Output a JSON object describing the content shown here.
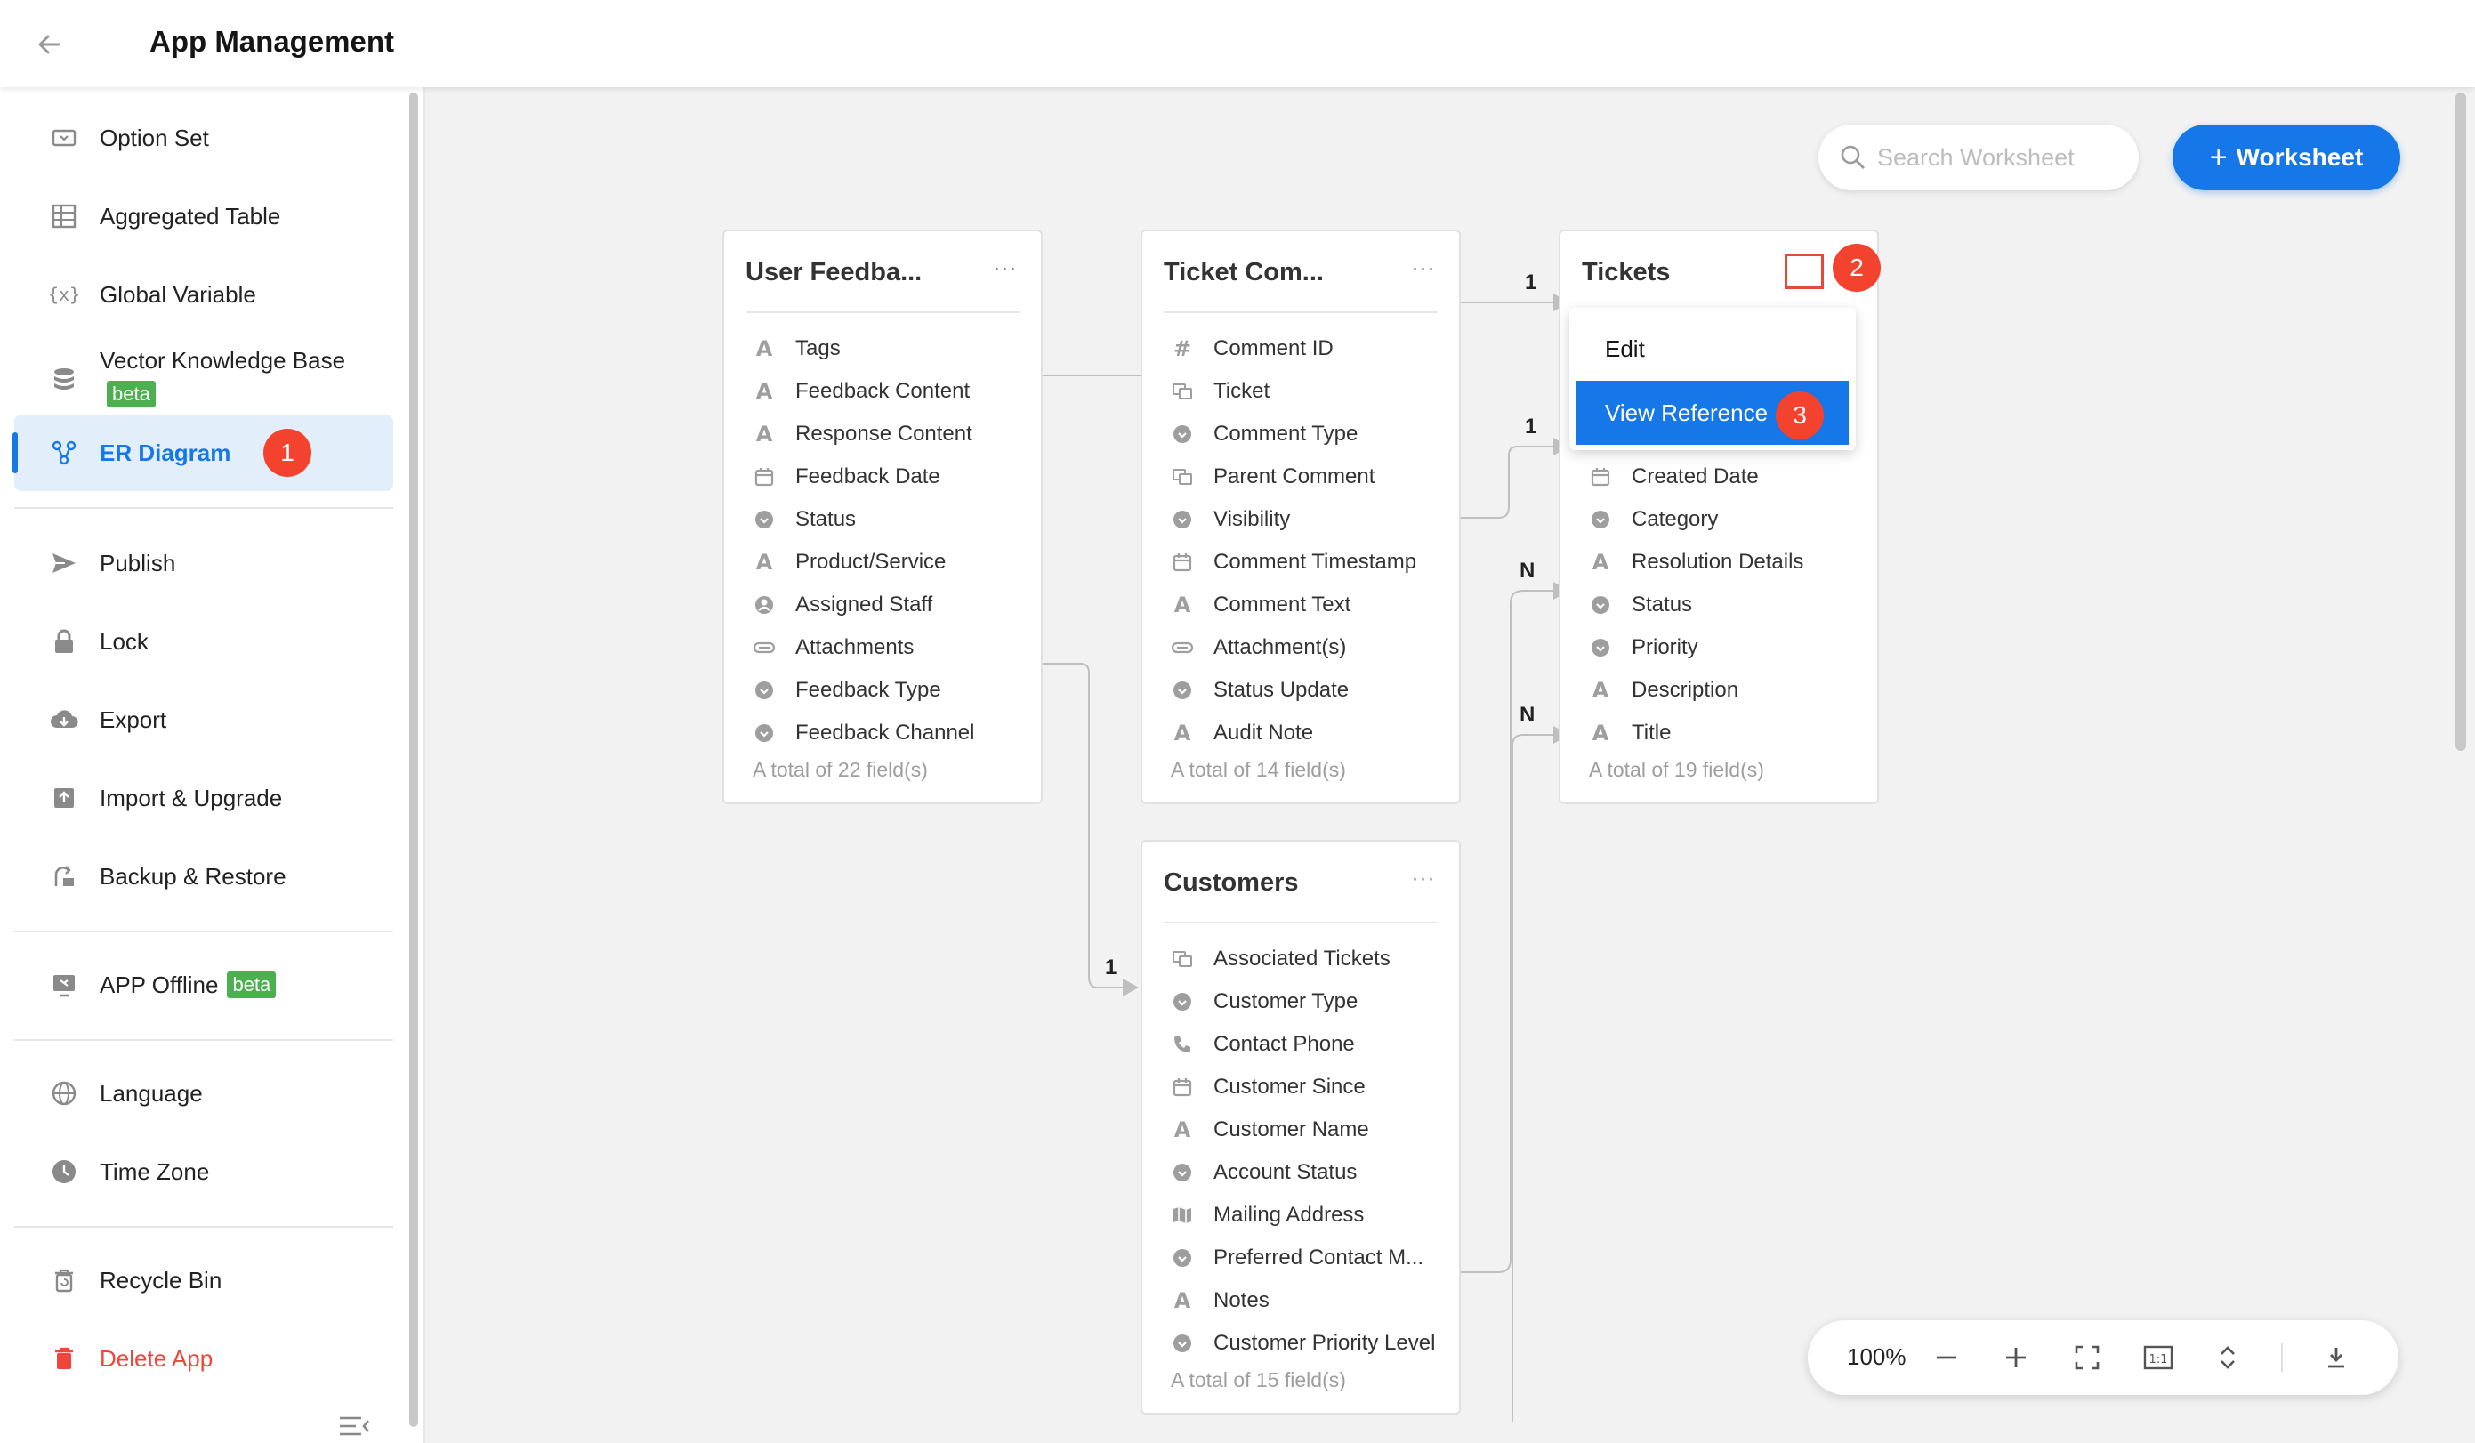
{
  "header": {
    "title": "App Management"
  },
  "sidebar": {
    "groups": [
      [
        {
          "label": "Option Set",
          "icon": "option-set-icon"
        },
        {
          "label": "Aggregated Table",
          "icon": "aggregated-table-icon"
        },
        {
          "label": "Global Variable",
          "icon": "global-variable-icon"
        },
        {
          "label": "Vector Knowledge Base",
          "icon": "database-icon",
          "badge": "beta"
        },
        {
          "label": "ER Diagram",
          "icon": "er-diagram-icon",
          "active": true
        }
      ],
      [
        {
          "label": "Publish",
          "icon": "send-icon"
        },
        {
          "label": "Lock",
          "icon": "lock-icon"
        },
        {
          "label": "Export",
          "icon": "cloud-download-icon"
        },
        {
          "label": "Import & Upgrade",
          "icon": "import-icon"
        },
        {
          "label": "Backup & Restore",
          "icon": "backup-icon"
        }
      ],
      [
        {
          "label": "APP Offline",
          "icon": "offline-icon",
          "badge": "beta"
        }
      ],
      [
        {
          "label": "Language",
          "icon": "globe-icon"
        },
        {
          "label": "Time Zone",
          "icon": "clock-icon"
        }
      ],
      [
        {
          "label": "Recycle Bin",
          "icon": "trash-icon"
        },
        {
          "label": "Delete App",
          "icon": "delete-icon",
          "danger": true
        }
      ]
    ]
  },
  "toolbar": {
    "search_placeholder": "Search Worksheet",
    "add_worksheet_label": "Worksheet",
    "zoom": "100%"
  },
  "tables": [
    {
      "title": "User Feedba...",
      "fields": [
        {
          "label": "Tags",
          "icon": "text"
        },
        {
          "label": "Feedback Content",
          "icon": "text"
        },
        {
          "label": "Response Content",
          "icon": "text"
        },
        {
          "label": "Feedback Date",
          "icon": "date"
        },
        {
          "label": "Status",
          "icon": "option"
        },
        {
          "label": "Product/Service",
          "icon": "text"
        },
        {
          "label": "Assigned Staff",
          "icon": "user"
        },
        {
          "label": "Attachments",
          "icon": "attach"
        },
        {
          "label": "Feedback Type",
          "icon": "option"
        },
        {
          "label": "Feedback Channel",
          "icon": "option"
        }
      ],
      "total": "A total of 22 field(s)"
    },
    {
      "title": "Ticket Com...",
      "fields": [
        {
          "label": "Comment ID",
          "icon": "number"
        },
        {
          "label": "Ticket",
          "icon": "relation"
        },
        {
          "label": "Comment Type",
          "icon": "option"
        },
        {
          "label": "Parent Comment",
          "icon": "relation"
        },
        {
          "label": "Visibility",
          "icon": "option"
        },
        {
          "label": "Comment Timestamp",
          "icon": "date"
        },
        {
          "label": "Comment Text",
          "icon": "text"
        },
        {
          "label": "Attachment(s)",
          "icon": "attach"
        },
        {
          "label": "Status Update",
          "icon": "option"
        },
        {
          "label": "Audit Note",
          "icon": "text"
        }
      ],
      "total": "A total of 14 field(s)"
    },
    {
      "title": "Tickets",
      "fields": [
        {
          "label": "Created Date",
          "icon": "date"
        },
        {
          "label": "Category",
          "icon": "option"
        },
        {
          "label": "Resolution Details",
          "icon": "text"
        },
        {
          "label": "Status",
          "icon": "option"
        },
        {
          "label": "Priority",
          "icon": "option"
        },
        {
          "label": "Description",
          "icon": "text"
        },
        {
          "label": "Title",
          "icon": "text"
        }
      ],
      "total": "A total of 19 field(s)"
    },
    {
      "title": "Customers",
      "fields": [
        {
          "label": "Associated Tickets",
          "icon": "relation"
        },
        {
          "label": "Customer Type",
          "icon": "option"
        },
        {
          "label": "Contact Phone",
          "icon": "phone"
        },
        {
          "label": "Customer Since",
          "icon": "date"
        },
        {
          "label": "Customer Name",
          "icon": "text"
        },
        {
          "label": "Account Status",
          "icon": "option"
        },
        {
          "label": "Mailing Address",
          "icon": "map"
        },
        {
          "label": "Preferred Contact M...",
          "icon": "option"
        },
        {
          "label": "Notes",
          "icon": "text"
        },
        {
          "label": "Customer Priority Level",
          "icon": "option"
        }
      ],
      "total": "A total of 15 field(s)"
    }
  ],
  "context_menu": {
    "items": [
      "Edit",
      "View Reference"
    ],
    "selected": "View Reference"
  },
  "connectors": [
    "1",
    "1",
    "N",
    "N",
    "1"
  ],
  "annotations": [
    "1",
    "2",
    "3"
  ],
  "colors": {
    "accent": "#1677e8",
    "danger": "#f0453a",
    "beta": "#4caf50",
    "annotation": "#f3432f"
  }
}
